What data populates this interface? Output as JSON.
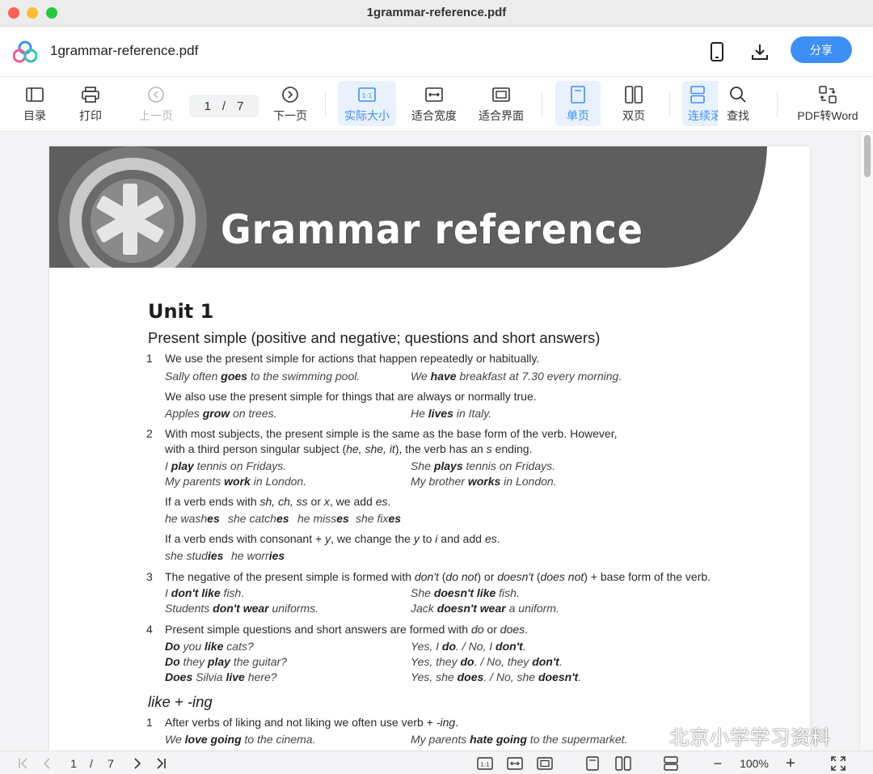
{
  "window": {
    "title": "1grammar-reference.pdf"
  },
  "header": {
    "doc_name": "1grammar-reference.pdf",
    "share_label": "分享"
  },
  "toolbar": {
    "toc": "目录",
    "print": "打印",
    "prev": "上一页",
    "page_current": "1",
    "page_sep": "/",
    "page_total": "7",
    "next": "下一页",
    "actual_size": "实际大小",
    "fit_width": "适合宽度",
    "fit_screen": "适合界面",
    "single": "单页",
    "double": "双页",
    "continuous": "连续滚",
    "find": "查找",
    "pdf_to_word": "PDF转Word",
    "one_to_one": "1:1"
  },
  "document": {
    "banner_title": "Grammar reference",
    "unit": "Unit 1",
    "section1": "Present simple (positive and negative; questions and short answers)",
    "n1": "1",
    "p1": "We use the present simple for actions that happen repeatedly or habitually.",
    "e1a_pre": "Sally often ",
    "e1a_b": "goes",
    "e1a_post": " to the swimming pool.",
    "e1b_pre": "We ",
    "e1b_b": "have",
    "e1b_post": " breakfast at 7.30 every morning.",
    "p1b": "We also use the present simple for things that are always or normally true.",
    "e1c_pre": "Apples ",
    "e1c_b": "grow",
    "e1c_post": " on trees.",
    "e1d_pre": "He ",
    "e1d_b": "lives",
    "e1d_post": " in Italy.",
    "n2": "2",
    "p2a": "With most subjects, the present simple is the same as the base form of the verb. However,",
    "p2b_1": "with a third person singular subject (",
    "p2b_i": "he, she, it",
    "p2b_2": "), the verb has an ",
    "p2b_s": "s",
    "p2b_3": " ending.",
    "e2a_pre": "I ",
    "e2a_b": "play",
    "e2a_post": " tennis on Fridays.",
    "e2b_pre": "She ",
    "e2b_b": "plays",
    "e2b_post": " tennis on Fridays.",
    "e2c_pre": "My parents ",
    "e2c_b": "work",
    "e2c_post": " in London.",
    "e2d_pre": "My brother ",
    "e2d_b": "works",
    "e2d_post": " in London.",
    "p2c_1": "If a verb ends with ",
    "p2c_i": "sh, ch, ss",
    "p2c_2": " or ",
    "p2c_x": "x",
    "p2c_3": ", we add ",
    "p2c_es": "es",
    "p2c_4": ".",
    "e2e_1": "he wash",
    "e2e_1b": "es",
    "e2e_2": "she catch",
    "e2e_2b": "es",
    "e2e_3": "he miss",
    "e2e_3b": "es",
    "e2e_4": "she fix",
    "e2e_4b": "es",
    "p2d_1": "If a verb ends with consonant + ",
    "p2d_y": "y",
    "p2d_2": ", we change the ",
    "p2d_y2": "y",
    "p2d_3": " to ",
    "p2d_i": "i",
    "p2d_4": " and add ",
    "p2d_es": "es",
    "p2d_5": ".",
    "e2f_1": "she stud",
    "e2f_1b": "ies",
    "e2f_2": "he worr",
    "e2f_2b": "ies",
    "n3": "3",
    "p3_1": "The negative of the present simple is formed with ",
    "p3_i1": "don't",
    "p3_2": " (",
    "p3_i2": "do not",
    "p3_3": ") or ",
    "p3_i3": "doesn't",
    "p3_4": " (",
    "p3_i4": "does not",
    "p3_5": ") + base form of the verb.",
    "e3a_pre": "I ",
    "e3a_b": "don't like",
    "e3a_post": " fish.",
    "e3b_pre": "She ",
    "e3b_b": "doesn't like",
    "e3b_post": " fish.",
    "e3c_pre": "Students ",
    "e3c_b": "don't wear",
    "e3c_post": " uniforms.",
    "e3d_pre": "Jack ",
    "e3d_b": "doesn't wear",
    "e3d_post": " a uniform.",
    "n4": "4",
    "p4_1": "Present simple questions and short answers are formed with ",
    "p4_i1": "do",
    "p4_2": " or ",
    "p4_i2": "does",
    "p4_3": ".",
    "e4a_b1": "Do",
    "e4a_m": " you ",
    "e4a_b2": "like",
    "e4a_post": " cats?",
    "e4b_1": "Yes, I ",
    "e4b_b1": "do",
    "e4b_2": ". / No, I ",
    "e4b_b2": "don't",
    "e4b_3": ".",
    "e4c_b1": "Do",
    "e4c_m": " they ",
    "e4c_b2": "play",
    "e4c_post": " the guitar?",
    "e4d_1": "Yes, they ",
    "e4d_b1": "do",
    "e4d_2": ". / No, they ",
    "e4d_b2": "don't",
    "e4d_3": ".",
    "e4e_b1": "Does",
    "e4e_m": " Silvia ",
    "e4e_b2": "live",
    "e4e_post": " here?",
    "e4f_1": "Yes, she ",
    "e4f_b1": "does",
    "e4f_2": ". / No, she ",
    "e4f_b2": "doesn't",
    "e4f_3": ".",
    "section2": "like + -ing",
    "n5": "1",
    "p5_1": "After verbs of liking and not liking we often use verb + ",
    "p5_i": "-ing",
    "p5_2": ".",
    "e5a_pre": "We ",
    "e5a_b": "love going",
    "e5a_post": " to the cinema.",
    "e5b_pre": "My parents ",
    "e5b_b": "hate going",
    "e5b_post": " to the supermarket."
  },
  "statusbar": {
    "page_current": "1",
    "page_sep": "/",
    "page_total": "7",
    "zoom": "100%",
    "one_to_one": "1:1",
    "minus": "−",
    "plus": "+"
  },
  "watermark": {
    "text": "北京小学学习资料"
  },
  "colors": {
    "accent": "#3d8ff5",
    "banner": "#5f5f5f"
  }
}
